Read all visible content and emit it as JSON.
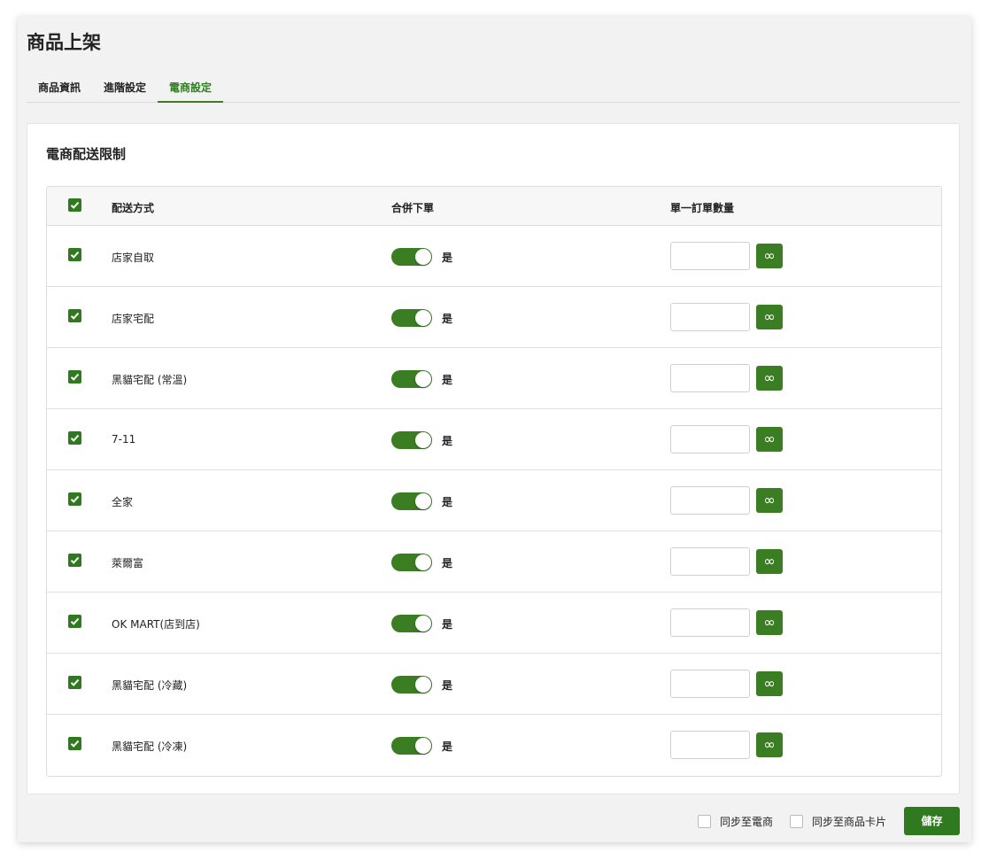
{
  "page": {
    "title": "商品上架"
  },
  "tabs": [
    {
      "label": "商品資訊",
      "active": false
    },
    {
      "label": "進階設定",
      "active": false
    },
    {
      "label": "電商設定",
      "active": true
    }
  ],
  "section": {
    "title": "電商配送限制"
  },
  "table": {
    "headers": {
      "method": "配送方式",
      "merge": "合併下單",
      "qty": "單一訂單數量"
    },
    "header_checked": true,
    "rows": [
      {
        "name": "店家自取",
        "checked": true,
        "merge_on": true,
        "merge_label": "是",
        "qty_value": "",
        "unlimited_symbol": "∞"
      },
      {
        "name": "店家宅配",
        "checked": true,
        "merge_on": true,
        "merge_label": "是",
        "qty_value": "",
        "unlimited_symbol": "∞"
      },
      {
        "name": "黑貓宅配 (常溫)",
        "checked": true,
        "merge_on": true,
        "merge_label": "是",
        "qty_value": "",
        "unlimited_symbol": "∞"
      },
      {
        "name": "7-11",
        "checked": true,
        "merge_on": true,
        "merge_label": "是",
        "qty_value": "",
        "unlimited_symbol": "∞"
      },
      {
        "name": "全家",
        "checked": true,
        "merge_on": true,
        "merge_label": "是",
        "qty_value": "",
        "unlimited_symbol": "∞"
      },
      {
        "name": "萊爾富",
        "checked": true,
        "merge_on": true,
        "merge_label": "是",
        "qty_value": "",
        "unlimited_symbol": "∞"
      },
      {
        "name": "OK MART(店到店)",
        "checked": true,
        "merge_on": true,
        "merge_label": "是",
        "qty_value": "",
        "unlimited_symbol": "∞"
      },
      {
        "name": "黑貓宅配 (冷藏)",
        "checked": true,
        "merge_on": true,
        "merge_label": "是",
        "qty_value": "",
        "unlimited_symbol": "∞"
      },
      {
        "name": "黑貓宅配 (冷凍)",
        "checked": true,
        "merge_on": true,
        "merge_label": "是",
        "qty_value": "",
        "unlimited_symbol": "∞"
      }
    ]
  },
  "footer": {
    "sync_ecommerce_label": "同步至電商",
    "sync_ecommerce_checked": false,
    "sync_card_label": "同步至商品卡片",
    "sync_card_checked": false,
    "save_label": "儲存"
  },
  "colors": {
    "accent": "#3a7d22",
    "accent_dark": "#2f7a1f",
    "background": "#f2f2f2"
  }
}
